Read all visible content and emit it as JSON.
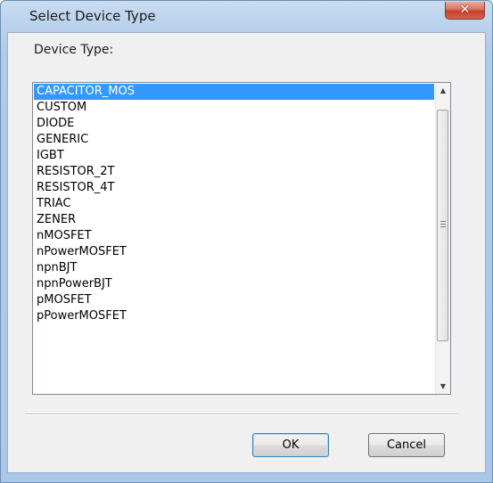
{
  "window": {
    "title": "Select Device Type"
  },
  "icons": {
    "close": "close-icon",
    "scroll_up": "chevron-up-icon",
    "scroll_down": "chevron-down-icon"
  },
  "dialog": {
    "label": "Device Type:",
    "selected_item": "CAPACITOR_MOS",
    "items": [
      "CAPACITOR_MOS",
      "CUSTOM",
      "DIODE",
      "GENERIC",
      "IGBT",
      "RESISTOR_2T",
      "RESISTOR_4T",
      "TRIAC",
      "ZENER",
      "nMOSFET",
      "nPowerMOSFET",
      "npnBJT",
      "npnPowerBJT",
      "pMOSFET",
      "pPowerMOSFET"
    ]
  },
  "buttons": {
    "ok": "OK",
    "cancel": "Cancel"
  },
  "colors": {
    "selection": "#3399ff",
    "close_button": "#c7402a"
  }
}
